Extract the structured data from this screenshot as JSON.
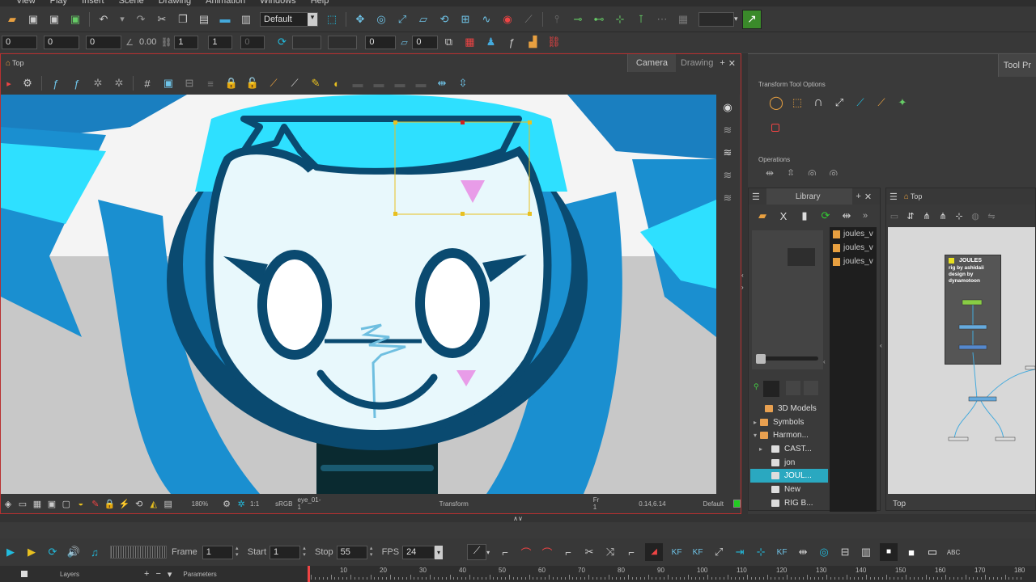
{
  "menubar": [
    "View",
    "Play",
    "Insert",
    "Scene",
    "Drawing",
    "Animation",
    "Windows",
    "Help"
  ],
  "toolbar": {
    "preset": "Default",
    "fields": [
      "0",
      "0",
      "0",
      "0.00",
      "1",
      "1",
      "0",
      "0",
      "0"
    ]
  },
  "viewport": {
    "breadcrumb": "Top",
    "tabs": [
      "Camera",
      "Drawing"
    ],
    "status": {
      "zoom": "180%",
      "ratio": "1:1",
      "colorspace": "sRGB",
      "drawing": "eye_01-1",
      "tool": "Transform",
      "frame": "Fr 1",
      "coords": "0.14,6.14",
      "palette": "Default"
    }
  },
  "tool_properties": {
    "tab": "Tool Pr",
    "header": "Transform Tool Options",
    "operations": "Operations"
  },
  "library": {
    "title": "Library",
    "items": [
      "joules_v",
      "joules_v",
      "joules_v"
    ],
    "tree": [
      {
        "label": "3D Models",
        "arrow": "",
        "folder": "orange"
      },
      {
        "label": "Symbols",
        "arrow": "▸",
        "folder": "orange"
      },
      {
        "label": "Harmon...",
        "arrow": "▾",
        "folder": "orange"
      },
      {
        "label": "CAST...",
        "arrow": "▸",
        "folder": "white"
      },
      {
        "label": "jon",
        "arrow": "",
        "folder": "white"
      },
      {
        "label": "JOUL...",
        "arrow": "",
        "folder": "white",
        "selected": true
      },
      {
        "label": "New",
        "arrow": "",
        "folder": "white"
      },
      {
        "label": "RIG B...",
        "arrow": "",
        "folder": "white"
      }
    ]
  },
  "node_view": {
    "breadcrumb": "Top",
    "footer": "Top",
    "backdrop_title": "JOULES",
    "backdrop_note": "rig by ashidaii\ndesign by\ndynamotoon"
  },
  "timeline": {
    "frame_label": "Frame",
    "frame": "1",
    "start_label": "Start",
    "start": "1",
    "stop_label": "Stop",
    "stop": "55",
    "fps_label": "FPS",
    "fps": "24",
    "layers_label": "Layers",
    "params_label": "Parameters",
    "ticks": [
      "10",
      "20",
      "30",
      "40",
      "50",
      "60",
      "70",
      "80",
      "90",
      "100",
      "110",
      "120",
      "130",
      "140",
      "150",
      "160",
      "170",
      "180"
    ]
  },
  "colors": {
    "accent": "#2aa8c0",
    "hair_light": "#2ee0ff",
    "hair_dark": "#1080c0",
    "outline": "#0a4a70",
    "face": "#e8f8fc",
    "marker": "#e89ce8",
    "selection": "#e8c020"
  }
}
